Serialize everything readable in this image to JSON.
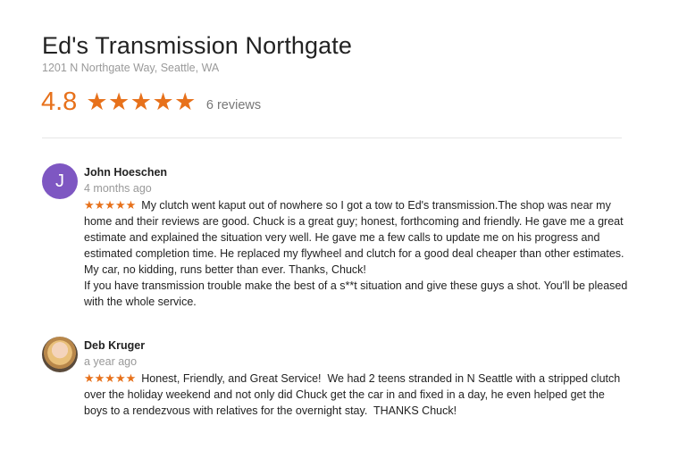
{
  "business": {
    "name": "Ed's Transmission Northgate",
    "address": "1201 N Northgate Way, Seattle, WA",
    "rating": "4.8",
    "stars": "★★★★★",
    "review_count": "6 reviews"
  },
  "colors": {
    "accent_orange": "#e7711b",
    "avatar_purple": "#7e57c2"
  },
  "reviews": [
    {
      "author": "John Hoeschen",
      "avatar_letter": "J",
      "time": "4 months ago",
      "stars": "★★★★★",
      "rating": 5,
      "text": "My clutch went kaput out of nowhere so I got a tow to Ed's transmission.The shop was near my home and their reviews are good. Chuck is a great guy; honest, forthcoming and friendly. He gave me a great estimate and explained the situation very well. He gave me a few calls to update me on his progress and estimated completion time. He replaced my flywheel and clutch for a good deal cheaper than other estimates. My car, no kidding, runs better than ever. Thanks, Chuck!\nIf you have transmission trouble make the best of a s**t situation and give these guys a shot. You'll be pleased with the whole service."
    },
    {
      "author": "Deb Kruger",
      "time": "a year ago",
      "stars": "★★★★★",
      "rating": 5,
      "text": "Honest, Friendly, and Great Service!  We had 2 teens stranded in N Seattle with a stripped clutch over the holiday weekend and not only did Chuck get the car in and fixed in a day, he even helped get the boys to a rendezvous with relatives for the overnight stay.  THANKS Chuck!"
    }
  ]
}
